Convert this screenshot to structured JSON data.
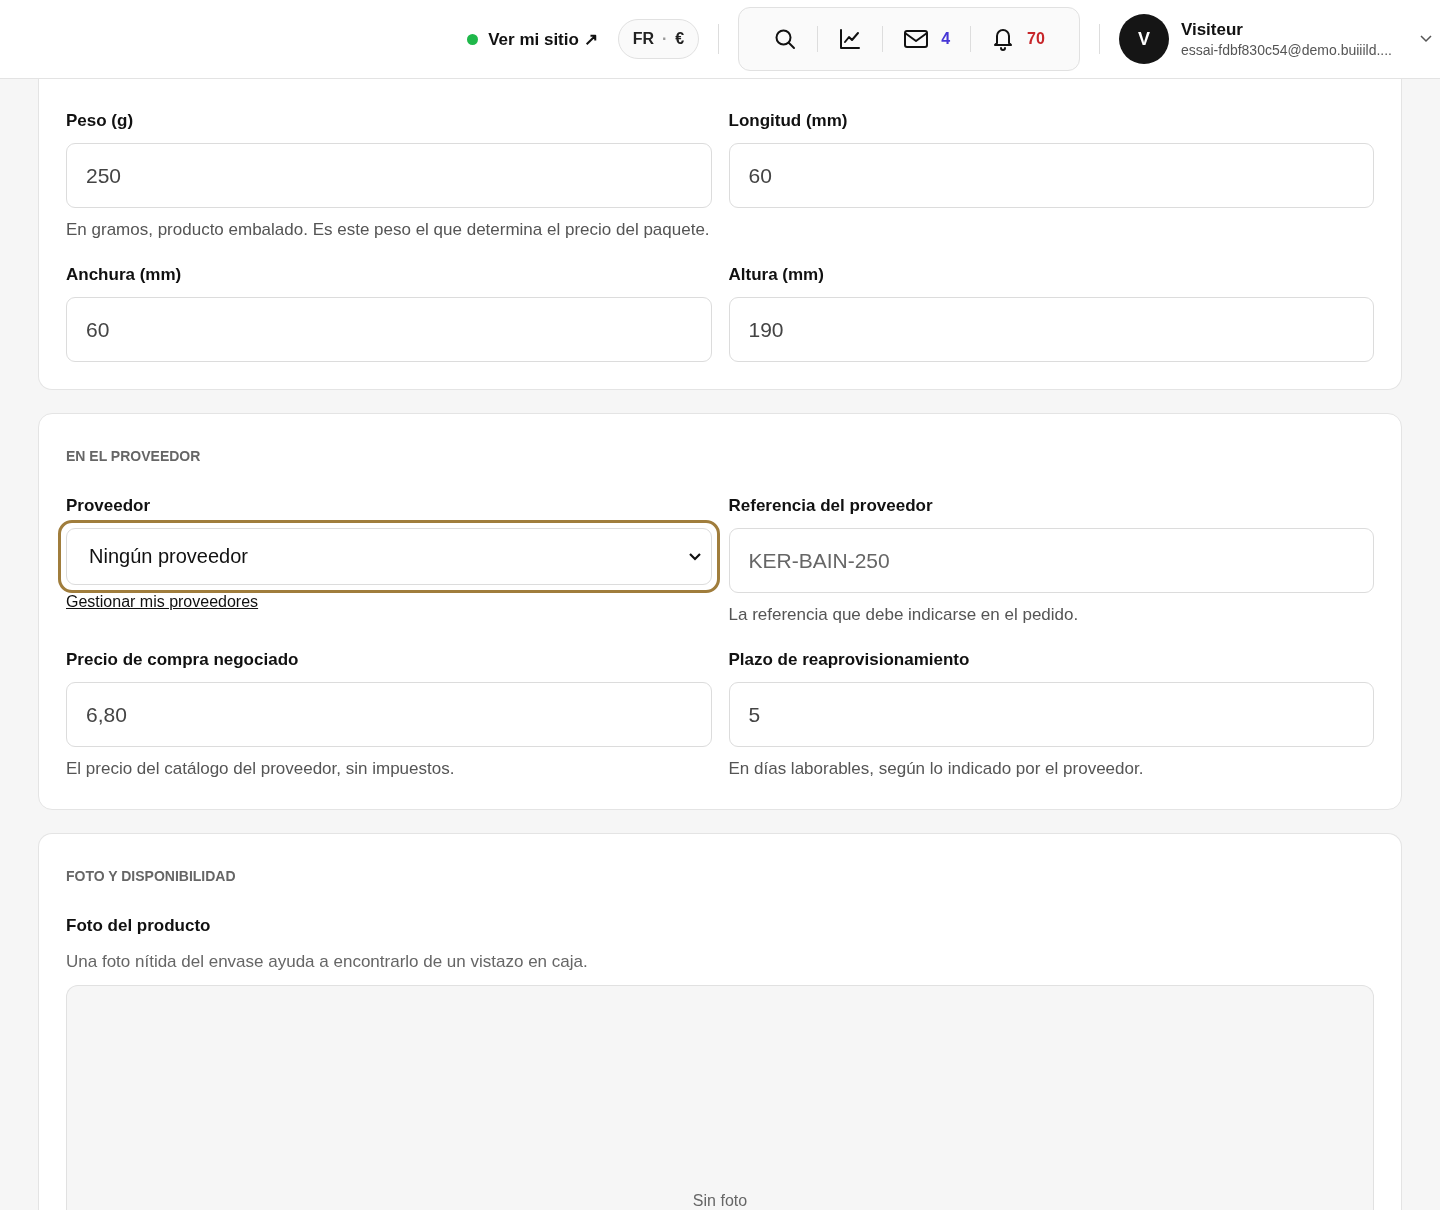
{
  "header": {
    "site_link": {
      "label": "Ver mi sitio ↗",
      "online": true
    },
    "locale": {
      "language": "FR",
      "separator": "·",
      "currency": "€"
    },
    "tools": [
      {
        "kind": "search"
      },
      {
        "kind": "chart"
      },
      {
        "kind": "mail",
        "count": "4"
      },
      {
        "kind": "bell",
        "count": "70"
      }
    ],
    "user": {
      "initial": "V",
      "name": "Visiteur",
      "email": "essai-fdbf830c54@demo.buiiild...."
    }
  },
  "sections": [
    {
      "fields": [
        {
          "kind": "input",
          "label": "Peso (g)",
          "value": "250",
          "help": "En gramos, producto embalado. Es este peso el que determina el precio del paquete."
        },
        {
          "kind": "input",
          "label": "Longitud (mm)",
          "value": "60"
        },
        {
          "kind": "input",
          "label": "Anchura (mm)",
          "value": "60"
        },
        {
          "kind": "input",
          "label": "Altura (mm)",
          "value": "190"
        }
      ]
    },
    {
      "title": "EN EL PROVEEDOR",
      "fields": [
        {
          "kind": "select",
          "label": "Proveedor",
          "value": "Ningún proveedor",
          "focused": true,
          "link": "Gestionar mis proveedores"
        },
        {
          "kind": "input",
          "label": "Referencia del proveedor",
          "placeholder": "KER-BAIN-250",
          "help": "La referencia que debe indicarse en el pedido."
        },
        {
          "kind": "input",
          "label": "Precio de compra negociado",
          "value": "6,80",
          "help": "El precio del catálogo del proveedor, sin impuestos."
        },
        {
          "kind": "input",
          "label": "Plazo de reaprovisionamiento",
          "value": "5",
          "help": "En días laborables, según lo indicado por el proveedor."
        }
      ]
    },
    {
      "title": "FOTO Y DISPONIBILIDAD",
      "fields": [
        {
          "kind": "photo",
          "label": "Foto del producto",
          "help": "Una foto nítida del envase ayuda a encontrarlo de un vistazo en caja.",
          "empty_text": "Sin foto"
        }
      ]
    }
  ]
}
